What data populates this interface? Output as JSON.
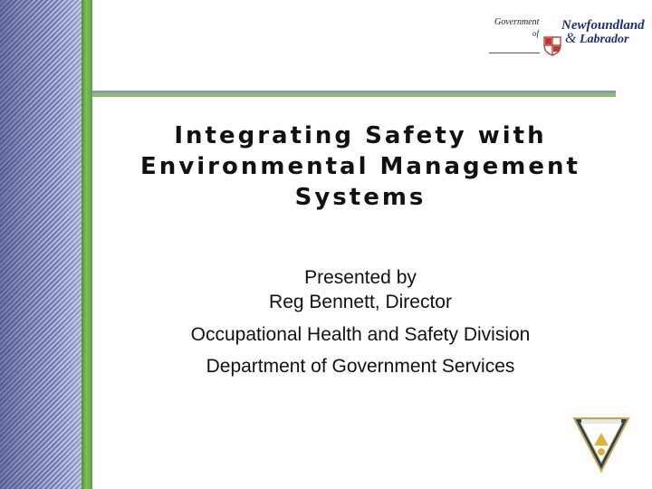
{
  "logo": {
    "line1": "Government",
    "line2": "of",
    "name1": "Newfoundland",
    "amp": "&",
    "name2": "Labrador"
  },
  "slide": {
    "title_lines": [
      "Integrating Safety with",
      "Environmental Management",
      "Systems"
    ],
    "presented_by": "Presented by",
    "presenter": "Reg Bennett, Director",
    "division": "Occupational Health and Safety Division",
    "department": "Department of Government Services"
  },
  "colors": {
    "stripe_dark": "#6f78ae",
    "stripe_light": "#b8bde0",
    "green_bar": "#7fbf5c",
    "rule_blue": "#7f9fb8",
    "rule_green": "#9ab86a",
    "logo_text": "#1d2f7a",
    "badge_gold": "#e0b23a"
  },
  "icons": {
    "government_logo": "provincial-shield-icon",
    "safety_badge": "safety-triangle-badge-icon"
  }
}
